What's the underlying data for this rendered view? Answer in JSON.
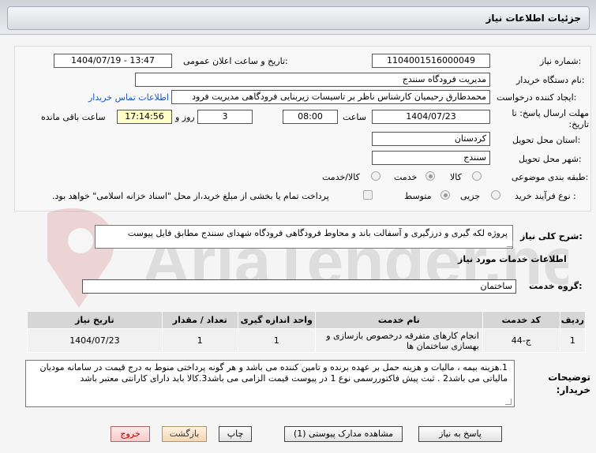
{
  "header": {
    "title": "جزئیات اطلاعات نیاز"
  },
  "form": {
    "need_number_label": "شماره نیاز:",
    "need_number": "1104001516000049",
    "announce_label": "تاریخ و ساعت اعلان عمومی:",
    "announce_value": "1404/07/19 - 13:47",
    "buyer_org_label": "نام دستگاه خریدار:",
    "buyer_org": "مدیریت فرودگاه سنندج",
    "creator_label": "ایجاد کننده درخواست:",
    "creator": "محمدطارق رحیمیان کارشناس ناظر بر تاسیسات زیربنایی فرودگاهی مدیریت فرود",
    "contact_link": "اطلاعات تماس خریدار",
    "deadline_label": "مهلت ارسال پاسخ: تا تاریخ:",
    "deadline_date": "1404/07/23",
    "time_label": "ساعت",
    "deadline_time": "08:00",
    "days_value": "3",
    "days_label": "روز و",
    "remaining_time": "17:14:56",
    "remaining_label": "ساعت باقی مانده",
    "province_label": "استان محل تحویل:",
    "province": "کردستان",
    "city_label": "شهر محل تحویل:",
    "city": "سنندج",
    "category_label": "طبقه بندی موضوعی:",
    "category_options": [
      "کالا",
      "خدمت",
      "کالا/خدمت"
    ],
    "category_selected": "خدمت",
    "process_label": "نوع فرآیند خرید :",
    "process_options": [
      "جزیی",
      "متوسط"
    ],
    "process_selected": "متوسط",
    "treasury_note": "پرداخت تمام یا بخشی از مبلغ خرید،از محل \"اسناد خزانه اسلامی\" خواهد بود."
  },
  "summary": {
    "label": "شرح کلی نیاز:",
    "text": "پروژه لکه گیری و درزگیری و آسفالت باند و محاوط فرودگاهی فرودگاه شهدای سنندج مطابق فایل پیوست"
  },
  "services": {
    "section_title": "اطلاعات خدمات مورد نیاز",
    "group_label": "گروه خدمت:",
    "group_value": "ساختمان",
    "columns": [
      "ردیف",
      "کد خدمت",
      "نام خدمت",
      "واحد اندازه گیری",
      "تعداد / مقدار",
      "تاریخ نیاز"
    ],
    "rows": [
      {
        "idx": "1",
        "code": "ج-44",
        "name": "انجام کارهای متفرقه درخصوص بازسازی و بهسازی ساختمان ها",
        "unit": "1",
        "qty": "1",
        "date": "1404/07/23"
      }
    ]
  },
  "notes": {
    "label": "توضیحات خریدار:",
    "text": "1.هزینه بیمه ، مالیات و هزینه حمل بر عهده  برنده و تامین کننده می باشد   و هر گونه پرداختی منوط به درج قیمت در سامانه مودیان مالیاتی می باشد2 . ثبت پیش فاکتوررسمی نوع 1 در پیوست قیمت الزامی می باشد3.کالا باید دارای کارانتی معتبر باشد"
  },
  "buttons": {
    "respond": "پاسخ به نیاز",
    "attachments": "مشاهده مدارک پیوستی (1)",
    "print": "چاپ",
    "back": "بازگشت",
    "exit": "خروج"
  }
}
